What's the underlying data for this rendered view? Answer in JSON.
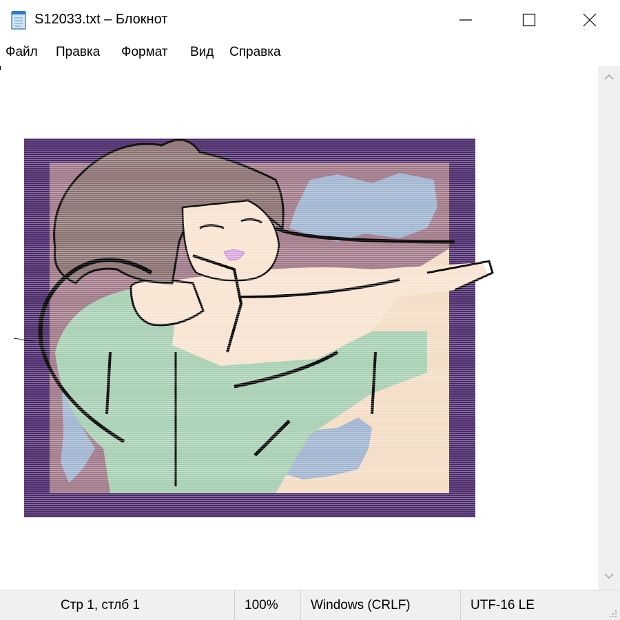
{
  "window": {
    "title": "S12033.txt – Блокнот",
    "icon": "notepad-icon",
    "controls": [
      "minimize-icon",
      "maximize-icon",
      "close-icon"
    ]
  },
  "menu": {
    "items": [
      {
        "label": "Файл"
      },
      {
        "label": "Правка"
      },
      {
        "label": "Формат"
      },
      {
        "label": "Вид"
      },
      {
        "label": "Справка"
      }
    ]
  },
  "status": {
    "position": "Стр 1, стлб 1",
    "zoom": "100%",
    "line_endings": "Windows (CRLF)",
    "encoding": "UTF-16 LE"
  },
  "colors": {
    "frame_purple": "#4a2a6a",
    "inner_mauve": "#a07888",
    "peach": "#f3dcc4",
    "cloud_blue": "#9fb4cf",
    "shirt_green": "#a6cfb2",
    "hair_brown": "#8a7070",
    "skin": "#f7e3d0"
  }
}
